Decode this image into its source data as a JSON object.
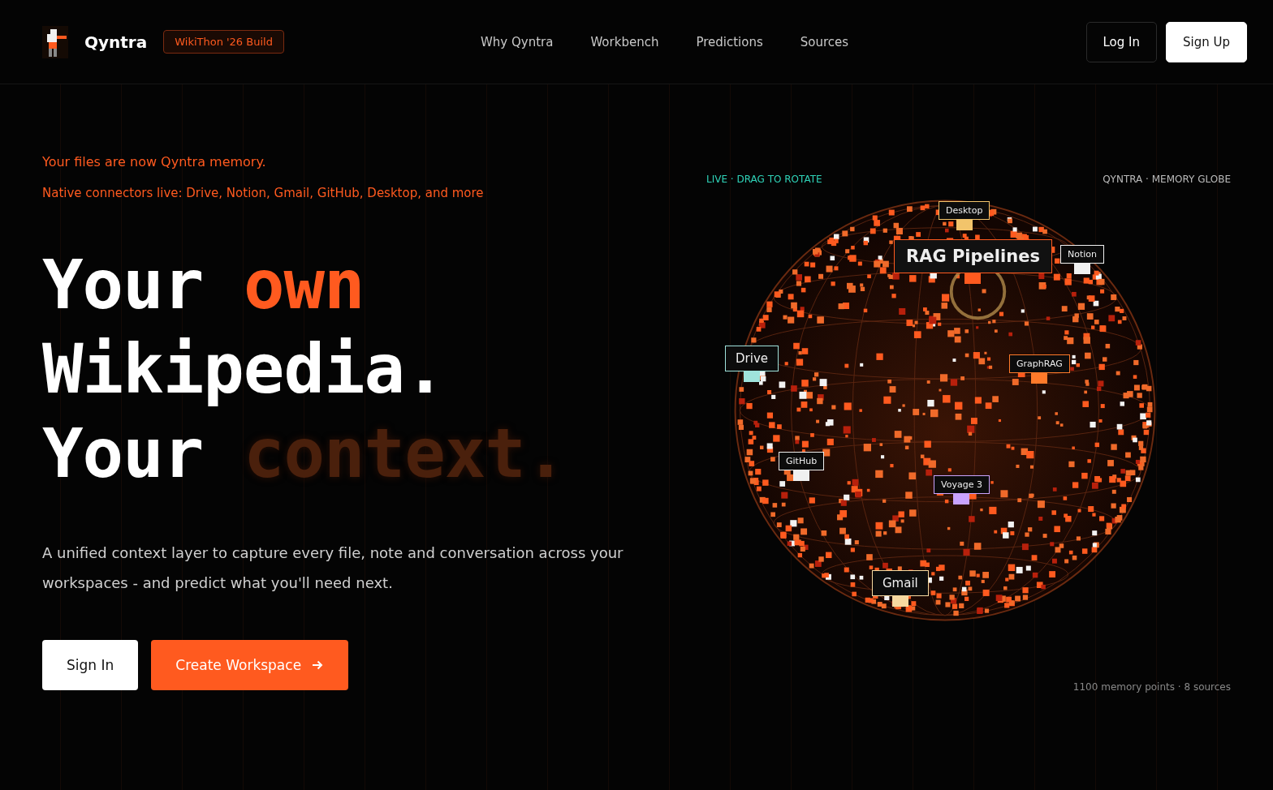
{
  "header": {
    "brand": "Qyntra",
    "badge": "WikiThon '26 Build",
    "nav": [
      {
        "label": "Why Qyntra"
      },
      {
        "label": "Workbench"
      },
      {
        "label": "Predictions"
      },
      {
        "label": "Sources"
      }
    ],
    "actions": [
      {
        "label": "Log In",
        "kind": "outline"
      },
      {
        "label": "Sign Up",
        "kind": "solid"
      }
    ]
  },
  "hero": {
    "eyebrow": "Your files are now Qyntra memory.",
    "connectors": "Native connectors live: Drive, Notion, Gmail, GitHub, Desktop, and more",
    "headline": [
      {
        "text": "Your",
        "kind": "plain"
      },
      {
        "text": "own",
        "kind": "accent"
      },
      {
        "text": "Wikipedia.",
        "kind": "plain"
      },
      {
        "text": "Your",
        "kind": "plain"
      },
      {
        "text": "context.",
        "kind": "faded"
      }
    ],
    "description": "A unified context layer to capture every file, note and conversation across your workspaces - and predict what you'll need next.",
    "buttons": [
      {
        "label": "Sign In",
        "kind": "light"
      },
      {
        "label": "Create Workspace",
        "kind": "primary"
      }
    ]
  },
  "globe": {
    "status": "LIVE · DRAG TO ROTATE",
    "title": "QYNTRA · MEMORY GLOBE",
    "labels": [
      {
        "text": "Desktop",
        "color": "#f2c46b",
        "kind": "small"
      },
      {
        "text": "RAG Pipelines",
        "color": "#ff5a1f",
        "kind": "large"
      },
      {
        "text": "Notion",
        "color": "#f0f0f0",
        "kind": "small"
      },
      {
        "text": "Drive",
        "color": "#9fe3dc",
        "kind": "medium"
      },
      {
        "text": "GraphRAG",
        "color": "#ff7a2a",
        "kind": "small"
      },
      {
        "text": "GitHub",
        "color": "#f0f0f0",
        "kind": "small"
      },
      {
        "text": "Voyage 3",
        "color": "#c9a3ff",
        "kind": "small"
      },
      {
        "text": "Gmail",
        "color": "#f7d9a0",
        "kind": "medium"
      }
    ],
    "caption": "1100 memory points · 8 sources"
  }
}
